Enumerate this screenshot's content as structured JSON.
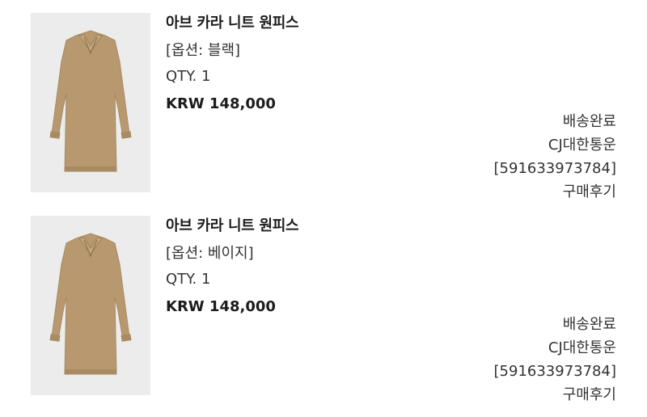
{
  "orders": [
    {
      "title": "아브 카라 니트 원피스",
      "option": "[옵션: 블랙]",
      "qty": "QTY. 1",
      "price": "KRW 148,000",
      "status": "배송완료",
      "courier": "CJ대한통운",
      "tracking": "[591633973784]",
      "review": "구매후기"
    },
    {
      "title": "아브 카라 니트 원피스",
      "option": "[옵션: 베이지]",
      "qty": "QTY. 1",
      "price": "KRW 148,000",
      "status": "배송완료",
      "courier": "CJ대한통운",
      "tracking": "[591633973784]",
      "review": "구매후기"
    }
  ],
  "colors": {
    "product_tan": "#b8996f",
    "thumb_bg": "#ececec"
  }
}
